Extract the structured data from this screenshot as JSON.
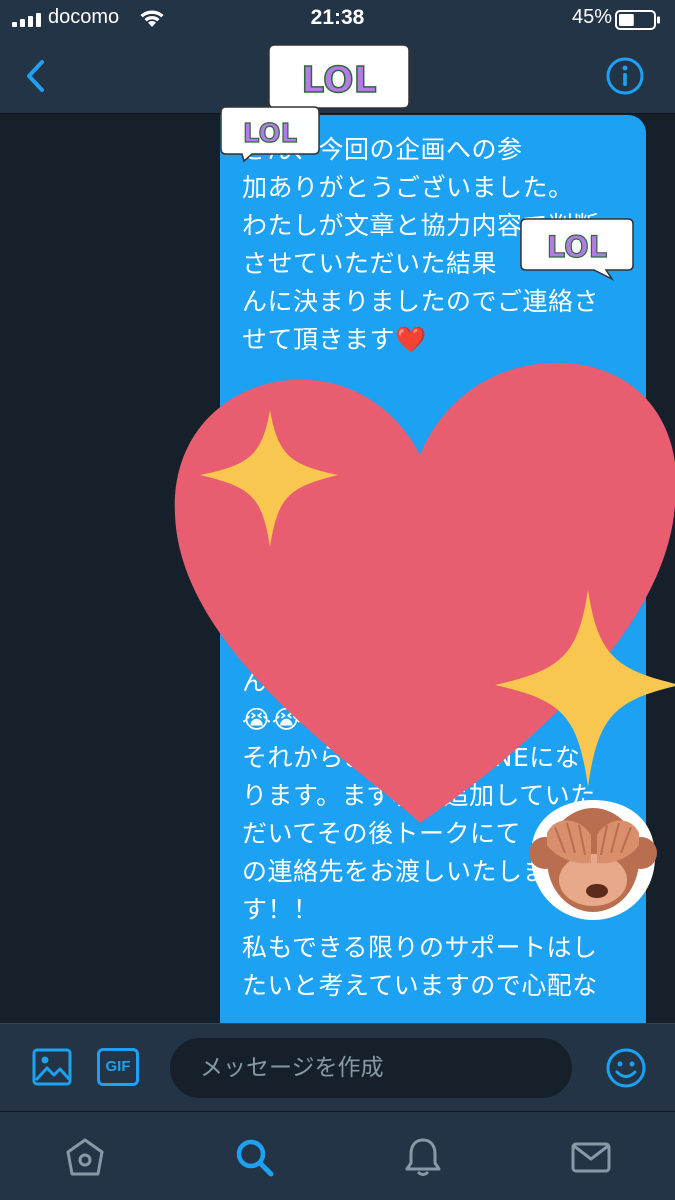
{
  "status_bar": {
    "carrier": "docomo",
    "time": "21:38",
    "battery_percent": "45%",
    "battery_level": 0.45
  },
  "nav": {
    "back_icon": "chevron-left-icon",
    "info_icon": "info-icon"
  },
  "message": {
    "text": "さん、今回の企画への参\n加ありがとうございました。\nわたしが文章と協力内容で判断\nさせていただいた結果\nんに決まりましたのでご連絡さ\nせて頂きます❤️\n\nするお\n\n\n\n\n\n\nん\n😭😭\nそれからお　　　　LINEにな\nります。まず私を追加していた\nだいてその後トークにて\nの連絡先をお渡しいたしま\nす！！\n私もできる限りのサポートはし\nたいと考えていますので心配な"
  },
  "stickers": {
    "lol_text": "LOL",
    "heart_color": "#e85d6f",
    "sparkle_color": "#f9c74f",
    "monkey": "see-no-evil-monkey"
  },
  "composer": {
    "placeholder": "メッセージを作成",
    "gif_label": "GIF",
    "image_icon": "image-icon",
    "emoji_icon": "smiley-icon"
  },
  "tabs": [
    {
      "name": "home",
      "icon": "home-icon"
    },
    {
      "name": "search",
      "icon": "search-icon",
      "active": true
    },
    {
      "name": "notifications",
      "icon": "bell-icon"
    },
    {
      "name": "messages",
      "icon": "mail-icon"
    }
  ],
  "colors": {
    "accent": "#1da1f2",
    "background": "#15202b",
    "bars": "#243447",
    "secondary_text": "#8899a6"
  }
}
